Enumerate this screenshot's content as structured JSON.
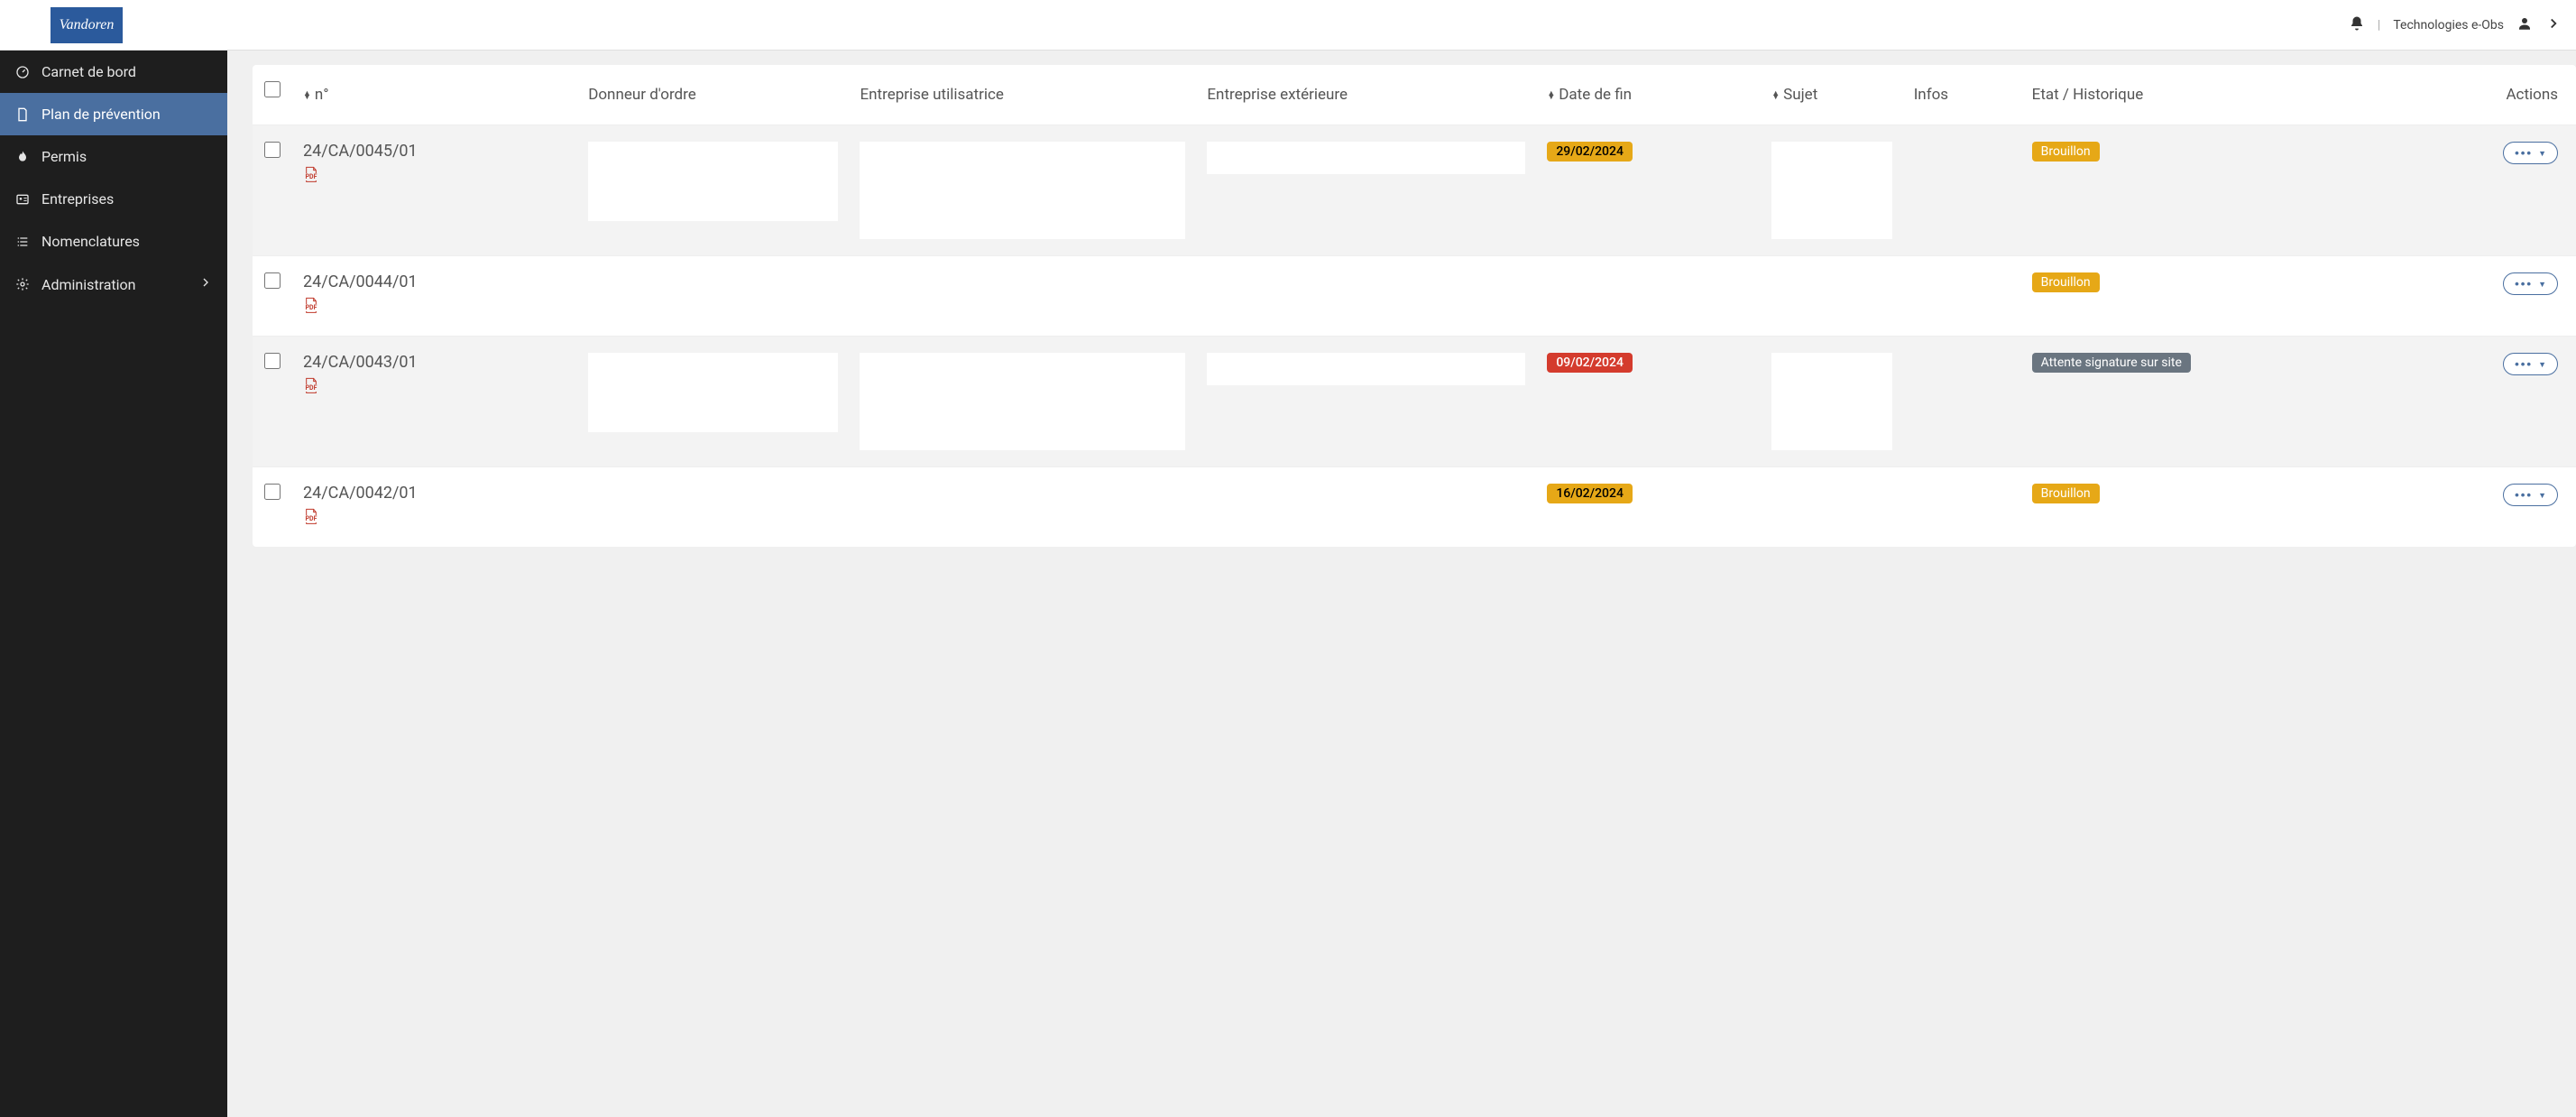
{
  "header": {
    "logo_text": "Vandoren",
    "user_label": "Technologies e-Obs"
  },
  "sidebar": {
    "items": [
      {
        "label": "Carnet de bord",
        "icon": "dashboard"
      },
      {
        "label": "Plan de prévention",
        "icon": "file",
        "active": true
      },
      {
        "label": "Permis",
        "icon": "flame"
      },
      {
        "label": "Entreprises",
        "icon": "id-card"
      },
      {
        "label": "Nomenclatures",
        "icon": "list"
      },
      {
        "label": "Administration",
        "icon": "gear",
        "expandable": true
      }
    ]
  },
  "table": {
    "headers": {
      "num": "n°",
      "donneur": "Donneur d'ordre",
      "utilisatrice": "Entreprise utilisatrice",
      "exterieure": "Entreprise extérieure",
      "date_fin": "Date de fin",
      "sujet": "Sujet",
      "infos": "Infos",
      "etat": "Etat / Historique",
      "actions": "Actions"
    },
    "rows": [
      {
        "num": "24/CA/0045/01",
        "date_fin": "29/02/2024",
        "date_kind": "warn",
        "etat": "Brouillon",
        "etat_kind": "brouillon",
        "tall": true
      },
      {
        "num": "24/CA/0044/01",
        "date_fin": "",
        "date_kind": "",
        "etat": "Brouillon",
        "etat_kind": "brouillon",
        "tall": false
      },
      {
        "num": "24/CA/0043/01",
        "date_fin": "09/02/2024",
        "date_kind": "danger",
        "etat": "Attente signature sur site",
        "etat_kind": "attente",
        "tall": true
      },
      {
        "num": "24/CA/0042/01",
        "date_fin": "16/02/2024",
        "date_kind": "warn",
        "etat": "Brouillon",
        "etat_kind": "brouillon",
        "tall": false
      }
    ]
  }
}
